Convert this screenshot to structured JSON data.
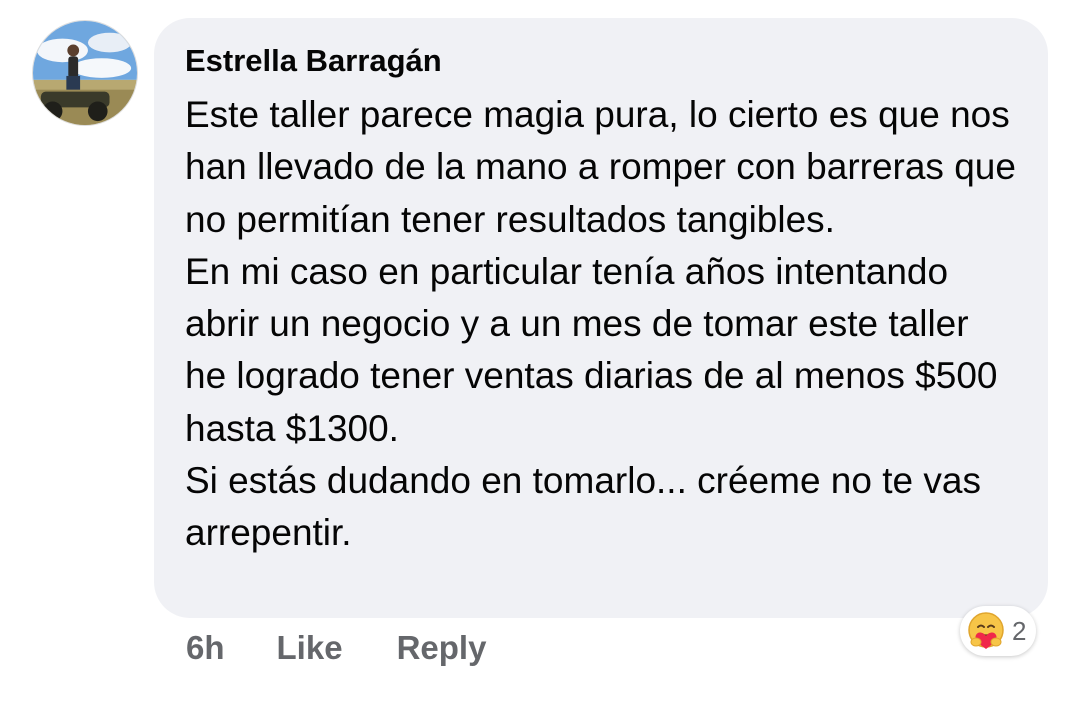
{
  "comment": {
    "author": "Estrella Barragán",
    "paragraphs": [
      "Este taller parece magia pura, lo cierto es que nos han llevado de la mano a romper con barreras que no permitían tener resultados tangibles.",
      "En mi caso en particular tenía años intentando abrir un negocio y a un mes de tomar este taller he logrado tener ventas diarias de al menos $500 hasta $1300.",
      "Si estás dudando en tomarlo... créeme no te vas arrepentir."
    ],
    "timestamp": "6h",
    "like_label": "Like",
    "reply_label": "Reply",
    "reactions": {
      "icon": "care-hug-emoji-icon",
      "count": "2"
    }
  },
  "colors": {
    "bubble": "#f0f1f5",
    "text": "#050505",
    "secondary": "#65676b"
  }
}
